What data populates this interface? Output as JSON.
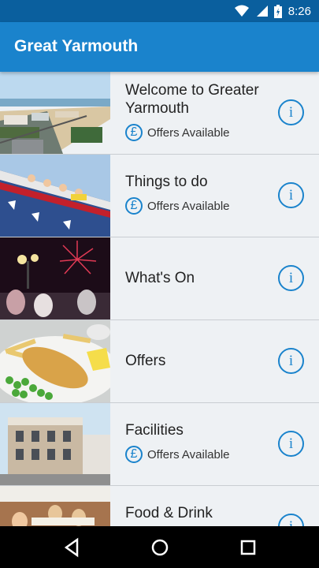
{
  "status": {
    "time": "8:26",
    "icons": [
      "wifi-icon",
      "signal-icon",
      "battery-icon"
    ]
  },
  "app": {
    "title": "Great Yarmouth"
  },
  "list": [
    {
      "title": "Welcome to Greater Yarmouth",
      "offers": "Offers Available",
      "thumb": "beach-aerial-photo"
    },
    {
      "title": "Things to do",
      "offers": "Offers Available",
      "thumb": "rollercoaster-photo"
    },
    {
      "title": "What's On",
      "offers": "",
      "thumb": "fireworks-photo"
    },
    {
      "title": "Offers",
      "offers": "",
      "thumb": "fish-and-chips-photo"
    },
    {
      "title": "Facilities",
      "offers": "Offers Available",
      "thumb": "building-photo"
    },
    {
      "title": "Food & Drink",
      "offers": "",
      "thumb": "restaurant-photo"
    }
  ],
  "icons": {
    "info": "i",
    "pound": "£"
  },
  "nav": {
    "buttons": [
      "back-icon",
      "home-icon",
      "recents-icon"
    ]
  },
  "colors": {
    "accent": "#1a83cc",
    "statusbar": "#0a5f9e"
  }
}
